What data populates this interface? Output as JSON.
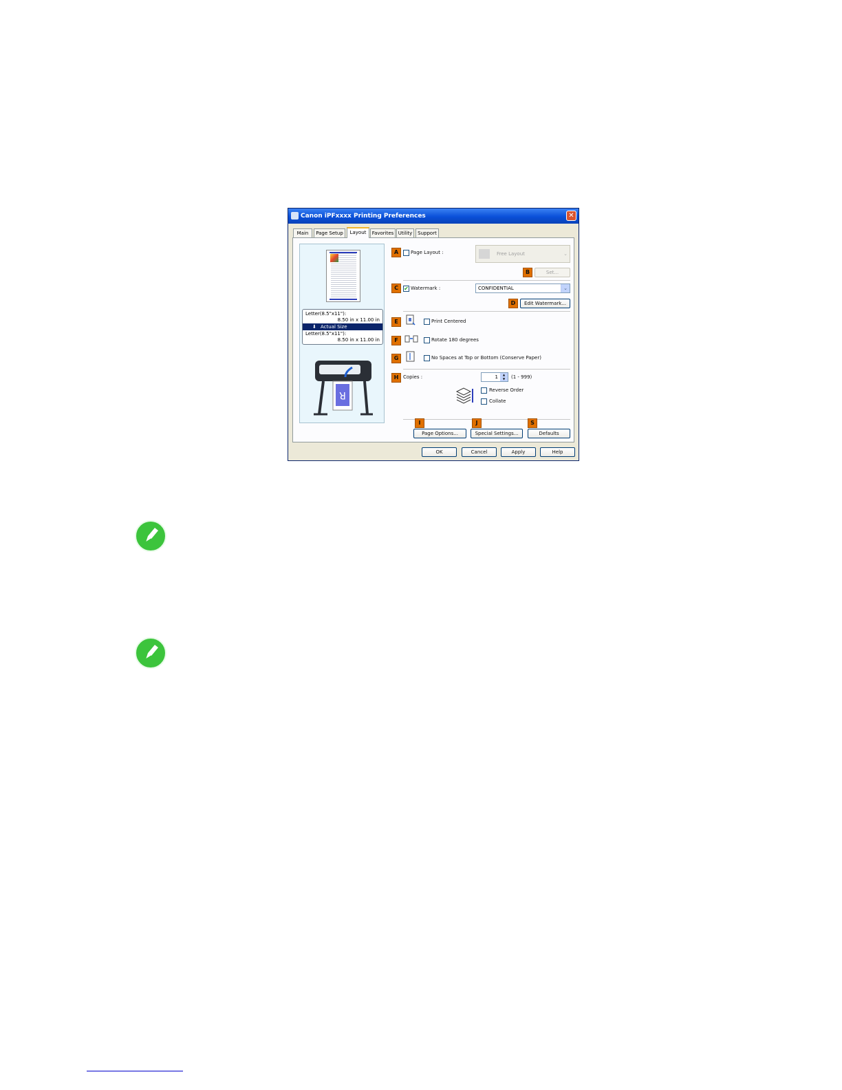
{
  "window": {
    "title": "Canon iPFxxxx Printing Preferences",
    "close_glyph": "✕"
  },
  "tabs": [
    "Main",
    "Page Setup",
    "Layout",
    "Favorites",
    "Utility",
    "Support"
  ],
  "active_tab": "Layout",
  "preview": {
    "line1": "Letter(8.5\"x11\"):",
    "line2": "8.50 in x 11.00 in",
    "actual_size": "Actual Size",
    "line3": "Letter(8.5\"x11\"):",
    "line4": "8.50 in x 11.00 in",
    "printer_letter": "R"
  },
  "options": {
    "A": {
      "letter": "A",
      "label": "Page Layout :",
      "checked": false,
      "combo_value": "Free Layout"
    },
    "B": {
      "letter": "B",
      "button": "Set..."
    },
    "C": {
      "letter": "C",
      "label": "Watermark :",
      "checked": true,
      "combo_value": "CONFIDENTIAL"
    },
    "D": {
      "letter": "D",
      "button": "Edit Watermark..."
    },
    "E": {
      "letter": "E",
      "label": "Print Centered",
      "checked": false
    },
    "F": {
      "letter": "F",
      "label": "Rotate 180 degrees",
      "checked": false
    },
    "G": {
      "letter": "G",
      "label": "No Spaces at Top or Bottom (Conserve Paper)",
      "checked": false
    },
    "H": {
      "letter": "H",
      "label": "Copies :",
      "value": "1",
      "range": "(1 - 999)",
      "reverse_order": "Reverse Order",
      "collate": "Collate"
    },
    "I": {
      "letter": "I",
      "button": "Page Options..."
    },
    "J": {
      "letter": "J",
      "button": "Special Settings..."
    },
    "S": {
      "letter": "S",
      "button": "Defaults"
    }
  },
  "dialog_buttons": {
    "ok": "OK",
    "cancel": "Cancel",
    "apply": "Apply",
    "help": "Help"
  },
  "icons": {
    "check": "✔",
    "dropdown": "⌄",
    "spin_up": "▲",
    "spin_down": "▼",
    "down_arrow": "⬇"
  },
  "colors": {
    "accent_letter": "#e07000",
    "note_icon": "#3cc43c",
    "title_bar": "#0a50d8"
  }
}
